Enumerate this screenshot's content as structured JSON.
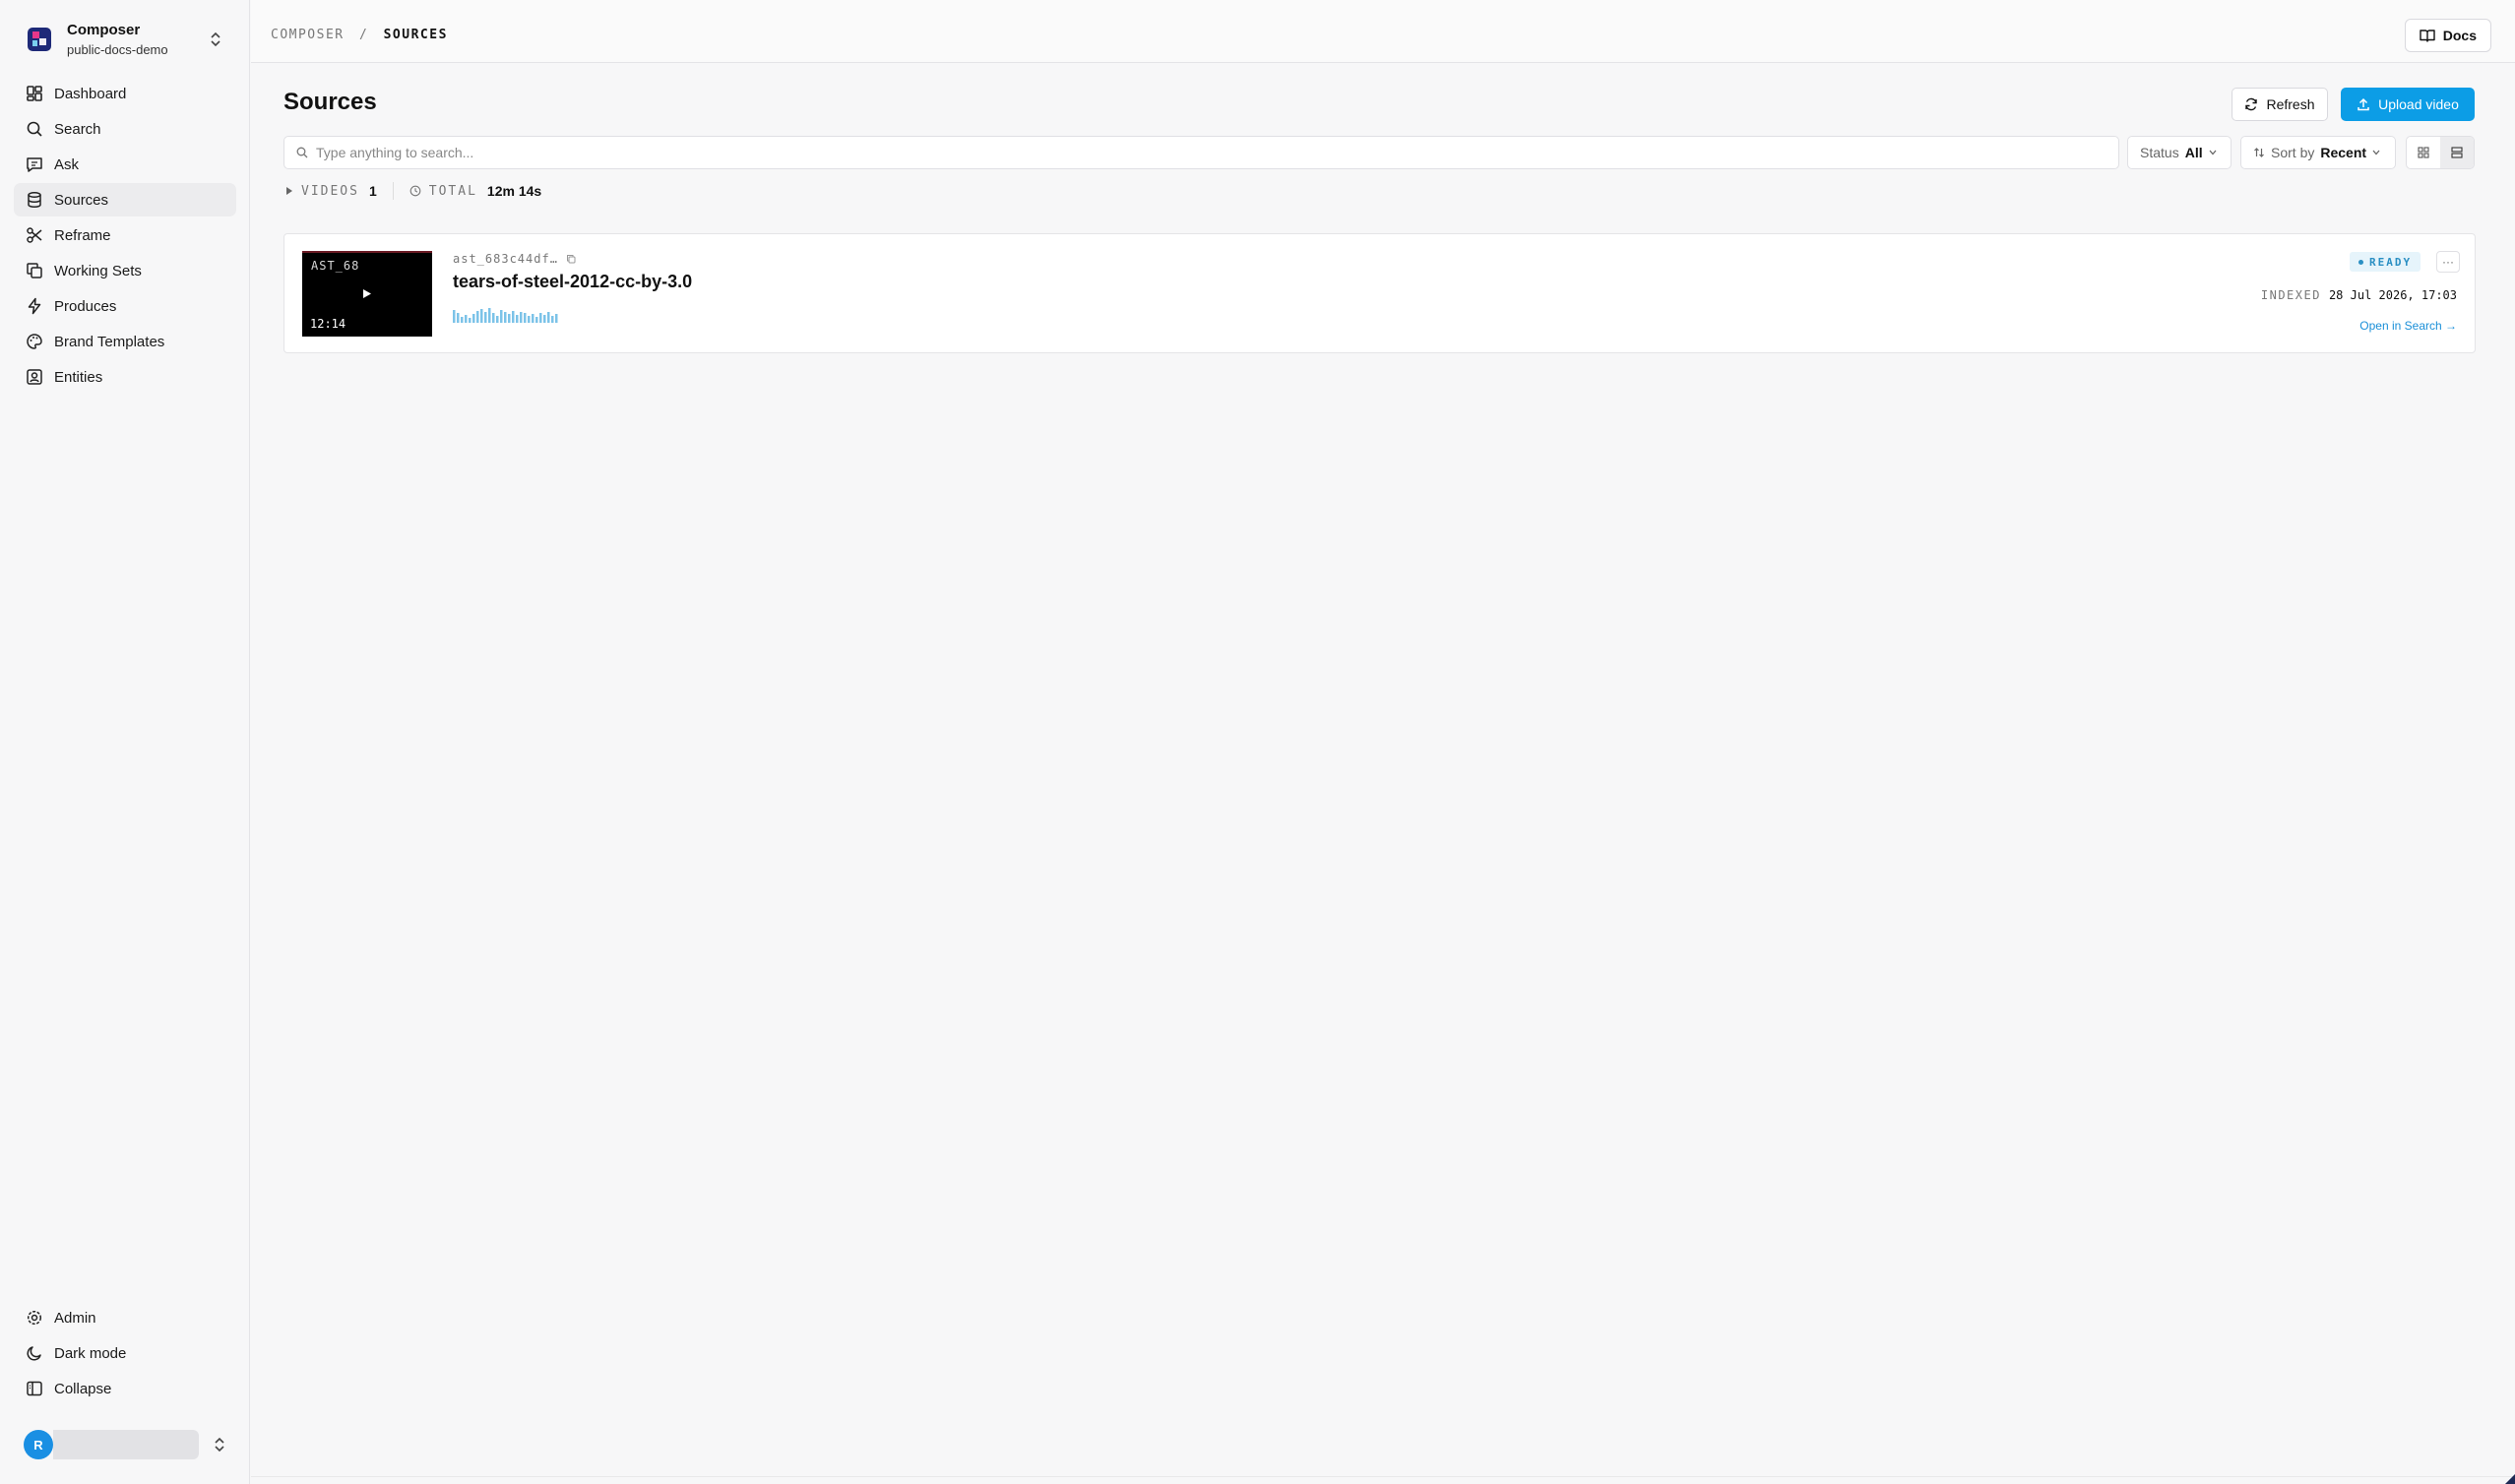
{
  "workspace": {
    "name": "Composer",
    "project": "public-docs-demo"
  },
  "sidebar": {
    "items": [
      {
        "label": "Dashboard",
        "icon": "dashboard-icon",
        "active": false
      },
      {
        "label": "Search",
        "icon": "search-icon",
        "active": false
      },
      {
        "label": "Ask",
        "icon": "chat-icon",
        "active": false
      },
      {
        "label": "Sources",
        "icon": "database-icon",
        "active": true
      },
      {
        "label": "Reframe",
        "icon": "scissors-icon",
        "active": false
      },
      {
        "label": "Working Sets",
        "icon": "copy-icon",
        "active": false
      },
      {
        "label": "Produces",
        "icon": "lightning-icon",
        "active": false
      },
      {
        "label": "Brand Templates",
        "icon": "palette-icon",
        "active": false
      },
      {
        "label": "Entities",
        "icon": "contact-icon",
        "active": false
      }
    ],
    "bottom": [
      {
        "label": "Admin",
        "icon": "gear-icon"
      },
      {
        "label": "Dark mode",
        "icon": "moon-icon"
      },
      {
        "label": "Collapse",
        "icon": "sidebar-collapse-icon"
      }
    ],
    "user_initial": "R"
  },
  "breadcrumb": {
    "root": "COMPOSER",
    "separator": "/",
    "current": "SOURCES"
  },
  "header": {
    "docs_label": "Docs"
  },
  "main": {
    "title": "Sources",
    "refresh_label": "Refresh",
    "upload_label": "Upload video",
    "search_placeholder": "Type anything to search...",
    "status_label": "Status",
    "status_value": "All",
    "sort_label": "Sort by",
    "sort_value": "Recent",
    "view_mode": "list"
  },
  "stats": {
    "videos_label": "VIDEOS",
    "videos_count": "1",
    "total_label": "TOTAL",
    "total_value": "12m 14s"
  },
  "sources": [
    {
      "thumb_label": "AST_68",
      "duration": "12:14",
      "asset_id": "ast_683c44df…",
      "title": "tears-of-steel-2012-cc-by-3.0",
      "status": "READY",
      "indexed_label": "INDEXED",
      "indexed_at": "28 Jul 2026, 17:03",
      "open_link": "Open in Search →",
      "more_label": "···"
    }
  ],
  "colors": {
    "accent": "#0c9de6",
    "status_ready_bg": "#e6f4fb",
    "status_ready_fg": "#2a8fc3",
    "logo": "#1e2a78"
  }
}
